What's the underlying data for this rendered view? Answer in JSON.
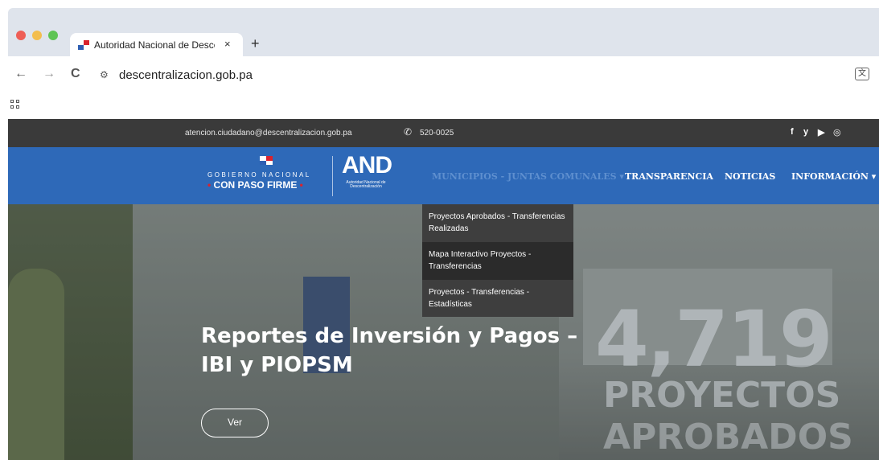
{
  "browser": {
    "tab_title": "Autoridad Nacional de Descentralización",
    "tab_close": "×",
    "new_tab": "+",
    "back": "←",
    "forward": "→",
    "reload": "C",
    "url": "descentralizacion.gob.pa"
  },
  "topbar": {
    "email": "atencion.ciudadano@descentralizacion.gob.pa",
    "phone": "520-0025",
    "social": [
      "f",
      "y",
      "▶",
      "◎"
    ]
  },
  "logo": {
    "gobierno": "GOBIERNO NACIONAL",
    "paso_firme": "CON PASO FIRME",
    "and": "AND",
    "and_sub": "Autoridad Nacional de Descentralización"
  },
  "menu": {
    "municipios": "MUNICIPIOS - JUNTAS COMUNALES ▾",
    "transparencia": "TRANSPARENCIA",
    "noticias": "NOTICIAS",
    "informacion": "INFORMACIÓN ▾"
  },
  "dropdown": {
    "items": [
      "Proyectos Aprobados - Transferencias Realizadas",
      "Mapa Interactivo Proyectos - Transferencias",
      "Proyectos - Transferencias - Estadísticas"
    ]
  },
  "hero": {
    "title_line1": "Reportes de Inversión y Pagos –",
    "title_line2": "IBI y PIOPSM",
    "button": "Ver",
    "big_number": "4,719",
    "big_line1": "PROYECTOS",
    "big_line2": "APROBADOS"
  },
  "colors": {
    "nav_blue": "#2e69b8",
    "topbar": "#3a3a3a",
    "dropdown": "#3e3e3e"
  }
}
